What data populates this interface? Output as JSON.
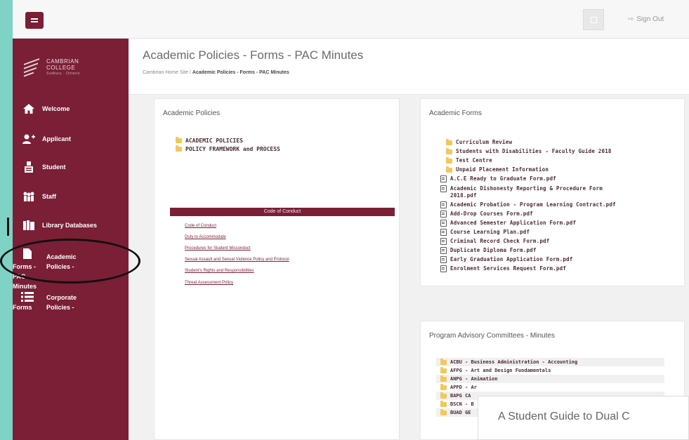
{
  "topbar": {
    "signout_label": "Sign Out"
  },
  "logo": {
    "line1": "CAMBRIAN",
    "line2": "COLLEGE",
    "line3": "Sudbury · Ontario"
  },
  "sidebar": {
    "items": [
      {
        "label": "Welcome",
        "icon": "home-icon"
      },
      {
        "label": "Applicant",
        "icon": "user-plus-icon"
      },
      {
        "label": "Student",
        "icon": "student-icon"
      },
      {
        "label": "Staff",
        "icon": "staff-icon"
      },
      {
        "label": "Library Databases",
        "icon": "books-icon"
      },
      {
        "label": "Academic Policies - Forms - PAC Minutes",
        "line1": "Academic Policies -",
        "line2": "Forms - PAC Minutes",
        "icon": "document-icon"
      },
      {
        "label": "Corporate Policies - Forms",
        "line1": "Corporate Policies -",
        "line2": "Forms",
        "icon": "list-icon"
      }
    ]
  },
  "header": {
    "title": "Academic Policies - Forms - PAC Minutes",
    "breadcrumb_home": "Cambrian Home Site",
    "breadcrumb_sep": "/",
    "breadcrumb_current": "Academic Policies - Forms - PAC Minutes"
  },
  "policies": {
    "title": "Academic Policies",
    "folders": [
      "ACADEMIC POLICIES",
      "POLICY FRAMEWORK and PROCESS"
    ],
    "code_title": "Code of Conduct",
    "links": [
      "Code of Conduct",
      "Duty to Accommodate",
      "Procedures for Student Misconduct",
      "Sexual Assault and Sexual Violence Policy and Protocol",
      "Student's Rights and Responsibilities",
      "Threat Assessment Policy"
    ]
  },
  "forms": {
    "title": "Academic Forms",
    "folders": [
      "Curriculum Review",
      "Students with Disabilities - Faculty Guide 2018",
      "Test Centre",
      "Unpaid Placement Information"
    ],
    "files": [
      "A.C.E Ready to Graduate Form.pdf",
      "Academic Dishonesty Reporting & Procedure Form",
      "2018.pdf",
      "Academic Probation - Program Learning Contract.pdf",
      "Add-Drop Courses Form.pdf",
      "Advanced Semester Application Form.pdf",
      "Course Learning Plan.pdf",
      "Criminal Record Check Form.pdf",
      "Duplicate Diploma Form.pdf",
      "Early Graduation Application Form.pdf",
      "Enrolment Services Request Form.pdf"
    ]
  },
  "pac": {
    "title": "Program Advisory Committees - Minutes",
    "rows": [
      "ACBU - Business Administration - Accounting",
      "AFPG - Art and Design Fundamentals",
      "ANPG - Animation",
      "APPD - Ar",
      "BAPG CA",
      "BSCN - B",
      "BUAD GE"
    ]
  },
  "caption": "A Student Guide to Dual C"
}
